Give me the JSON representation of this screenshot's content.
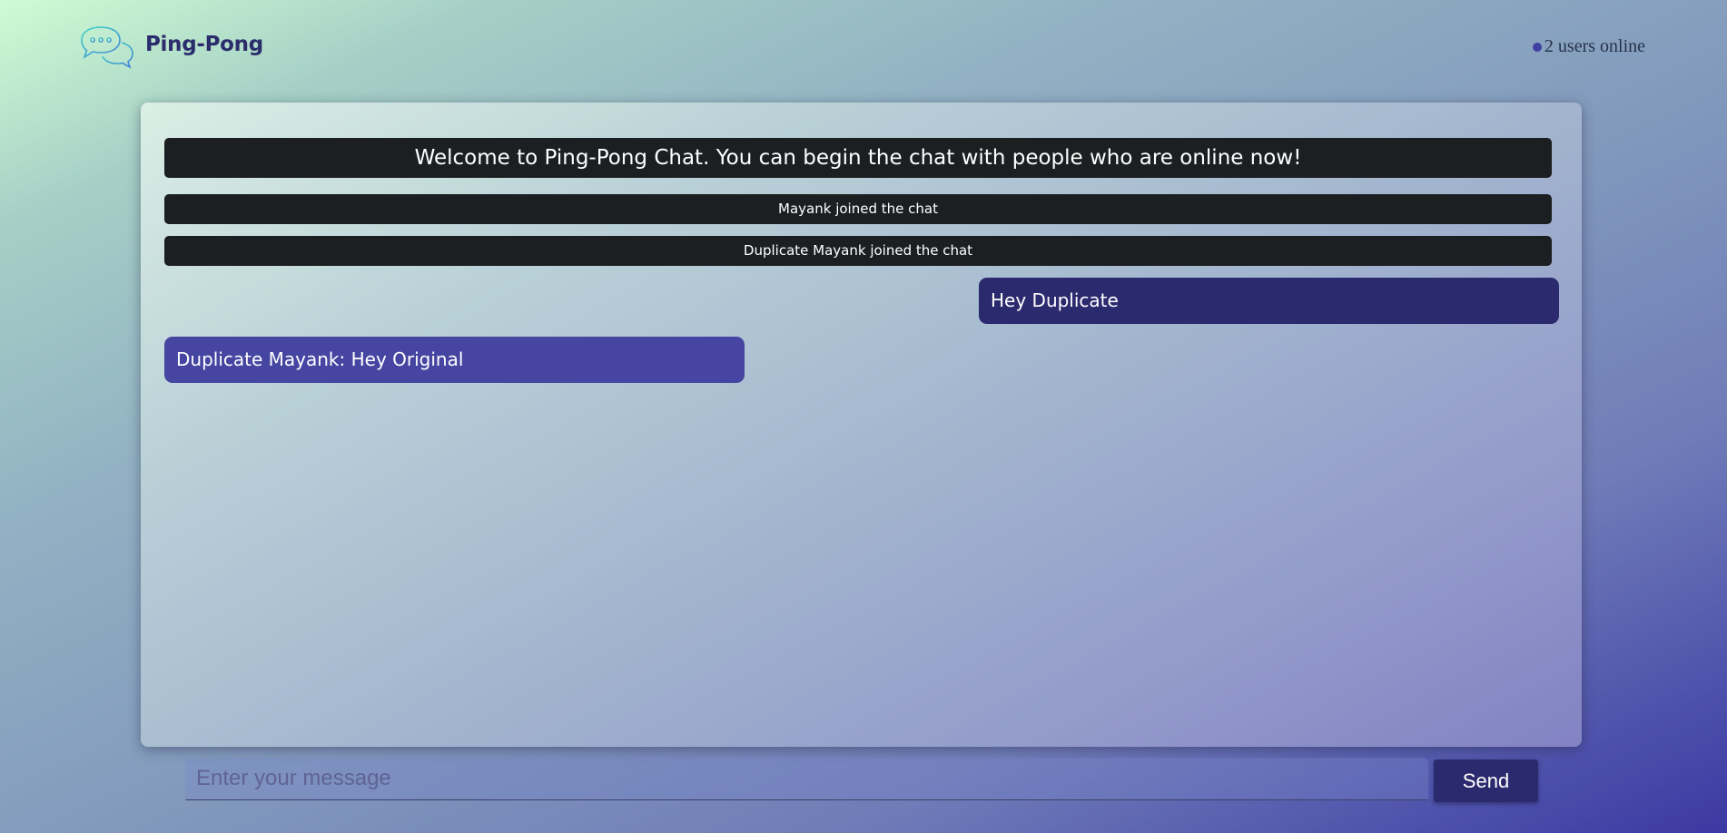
{
  "header": {
    "brand": "Ping-Pong",
    "logo_icon": "chat-bubbles-icon",
    "online_status": "2 users online",
    "online_dot_color": "#3f3ea1"
  },
  "chat": {
    "welcome": "Welcome to Ping-Pong Chat. You can begin the chat with people who are online now!",
    "notices": [
      "Mayank joined the chat",
      "Duplicate Mayank joined the chat"
    ],
    "messages": [
      {
        "direction": "outgoing",
        "text": "Hey Duplicate",
        "color": "#2c2a6e"
      },
      {
        "direction": "incoming",
        "text": "Duplicate Mayank: Hey Original",
        "color": "#4646a2"
      }
    ]
  },
  "composer": {
    "placeholder": "Enter your message",
    "value": "",
    "send_label": "Send"
  },
  "colors": {
    "notice_bg": "#1c1f21",
    "brand_text": "#2b2c6b",
    "send_button": "#2c2a6e"
  }
}
